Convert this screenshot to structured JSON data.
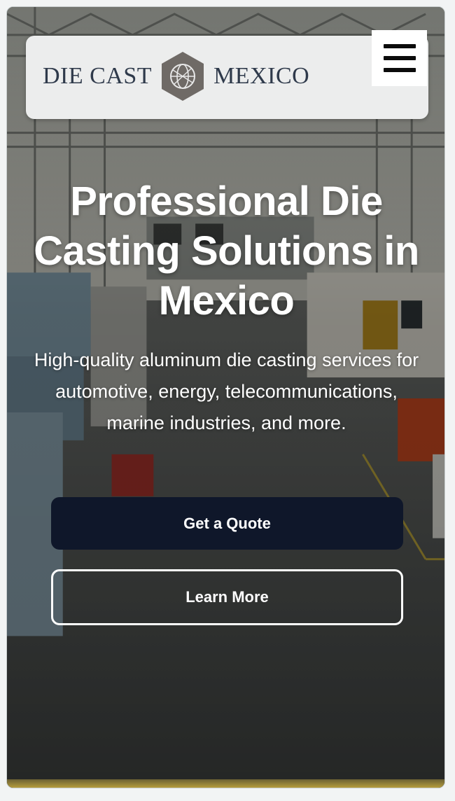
{
  "header": {
    "logo": {
      "left_text": "DIE CAST",
      "right_text": "MEXICO",
      "mark_icon": "globe-hexagon-icon"
    },
    "menu_icon": "hamburger-menu-icon"
  },
  "hero": {
    "title": "Professional Die Casting Solutions in Mexico",
    "subtitle": "High-quality aluminum die casting services for automotive, energy, telecommunications, marine industries, and more.",
    "primary_button": "Get a Quote",
    "secondary_button": "Learn More",
    "background": "factory-floor-photo"
  },
  "colors": {
    "primary_button_bg": "#0f172a",
    "header_bg": "#eceded",
    "logo_text": "#2f3a4b",
    "logo_mark": "#6f6a66"
  }
}
